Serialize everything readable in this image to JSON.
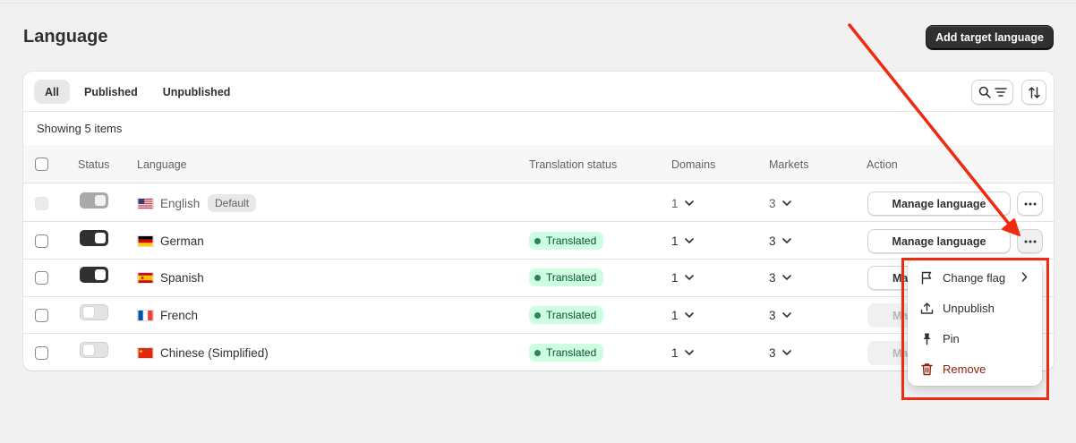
{
  "page": {
    "title": "Language",
    "primary_action": "Add target language"
  },
  "tabs": [
    {
      "label": "All",
      "active": true
    },
    {
      "label": "Published",
      "active": false
    },
    {
      "label": "Unpublished",
      "active": false
    }
  ],
  "toolbar": {
    "search_filter_icon": "search-filter-icon",
    "sort_icon": "sort-icon"
  },
  "showing_text": "Showing 5 items",
  "columns": [
    "Status",
    "Language",
    "Translation status",
    "Domains",
    "Markets",
    "Action"
  ],
  "rows": [
    {
      "language": "English",
      "flag": "us",
      "badge": "Default",
      "published": true,
      "disabled": true,
      "translation_status": "",
      "domains": "1",
      "markets": "3",
      "action": "Manage language"
    },
    {
      "language": "German",
      "flag": "de",
      "badge": "",
      "published": true,
      "disabled": false,
      "translation_status": "Translated",
      "domains": "1",
      "markets": "3",
      "action": "Manage language"
    },
    {
      "language": "Spanish",
      "flag": "es",
      "badge": "",
      "published": true,
      "disabled": false,
      "translation_status": "Translated",
      "domains": "1",
      "markets": "3",
      "action": "Ma"
    },
    {
      "language": "French",
      "flag": "fr",
      "badge": "",
      "published": false,
      "disabled": false,
      "translation_status": "Translated",
      "domains": "1",
      "markets": "3",
      "action": "Ma"
    },
    {
      "language": "Chinese (Simplified)",
      "flag": "cn",
      "badge": "",
      "published": false,
      "disabled": false,
      "translation_status": "Translated",
      "domains": "1",
      "markets": "3",
      "action": "Ma"
    }
  ],
  "menu": {
    "items": [
      {
        "label": "Change flag",
        "icon": "flag-icon",
        "has_submenu": true
      },
      {
        "label": "Unpublish",
        "icon": "upload-icon"
      },
      {
        "label": "Pin",
        "icon": "pin-icon"
      },
      {
        "label": "Remove",
        "icon": "trash-icon",
        "tone": "critical"
      }
    ]
  },
  "colors": {
    "annotation": "#ee2a10",
    "success_badge": "#cdfee1",
    "primary_button": "#303030",
    "critical": "#8e1f0b"
  }
}
